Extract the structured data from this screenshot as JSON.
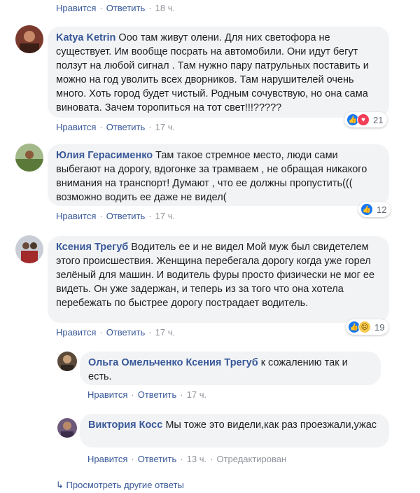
{
  "top_actions": {
    "like": "Нравится",
    "reply": "Ответить",
    "time": "18 ч."
  },
  "comments": [
    {
      "author": "Katya Ketrin",
      "text": "Ооо там живут олени. Для них светофора не существует. Им вообще посрать на автомобили. Они идут бегут ползут на любой сигнал . Там нужно пару патрульных поставить и можно на год уволить всех дворников. Там нарушителей очень много. Хоть город будет чистый. Родным сочувствую, но она сама виновата. Зачем торопиться на тот свет!!!?????",
      "like": "Нравится",
      "reply": "Ответить",
      "time": "17 ч.",
      "reactions": [
        "like",
        "love"
      ],
      "reaction_count": "21",
      "avatar_color": "#7a3b2e"
    },
    {
      "author": "Юлия Герасименко",
      "text": "Там такое стремное место, люди сами выбегают на дорогу, вдогонке за трамваем , не обращая никакого внимания на транспорт! Думают , что ее должны пропустить((( возможно водить ее даже не видел(",
      "like": "Нравится",
      "reply": "Ответить",
      "time": "17 ч.",
      "reactions": [
        "like"
      ],
      "reaction_count": "12",
      "avatar_color": "#8a6e4b"
    },
    {
      "author": "Ксения Трегуб",
      "text": "Водитель ее и не видел Мой муж был свидетелем этого происшествия. Женщина перебегала дорогу когда уже горел зелёный для машин. И водитель фуры просто физически не мог ее видеть. Он уже задержан, и теперь из за того что она хотела перебежать по быстрее дорогу пострадает водитель.",
      "like": "Нравится",
      "reply": "Ответить",
      "time": "17 ч.",
      "reactions": [
        "like",
        "sad"
      ],
      "reaction_count": "19",
      "avatar_color": "#9aa0a6"
    }
  ],
  "replies": [
    {
      "author": "Ольга Омельченко",
      "mention": "Ксения Трегуб",
      "text": "к сожалению так и есть.",
      "like": "Нравится",
      "reply": "Ответить",
      "time": "17 ч.",
      "avatar_color": "#5b4a3a"
    },
    {
      "author": "Виктория Косс",
      "text": "Мы тоже это видели,как раз проезжали,ужас",
      "like": "Нравится",
      "reply": "Ответить",
      "time": "13 ч.",
      "edited": "Отредактирован",
      "avatar_color": "#6d5a7a"
    }
  ],
  "more_replies": "Просмотреть другие ответы"
}
